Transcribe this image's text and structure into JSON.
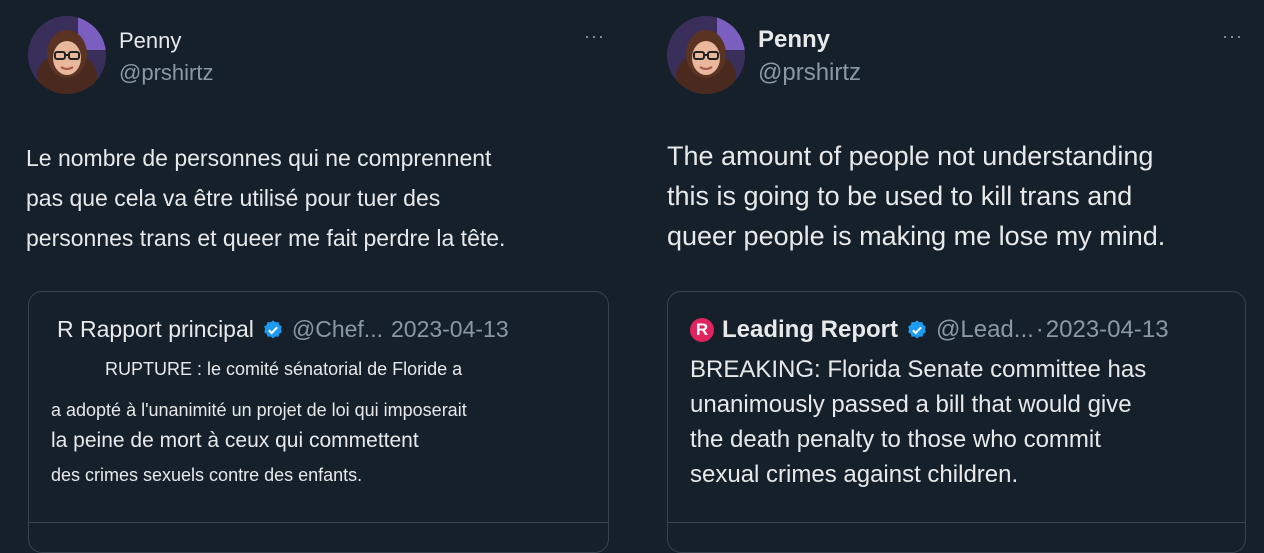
{
  "left": {
    "author": {
      "name": "Penny",
      "handle": "@prshirtz"
    },
    "more": "···",
    "text_lines": [
      "Le nombre de personnes qui ne comprennent",
      "pas que cela va être utilisé pour tuer des",
      "personnes trans et queer me fait perdre la tête."
    ],
    "quote": {
      "name": "R Rapport principal",
      "handle": "@Chef...",
      "date": "2023-04-13",
      "lines": [
        "RUPTURE : le comité sénatorial de Floride a",
        "a adopté à l'unanimité un projet de loi qui imposerait",
        "la peine de mort à ceux qui commettent",
        "des crimes sexuels contre des enfants."
      ]
    }
  },
  "right": {
    "author": {
      "name": "Penny",
      "handle": "@prshirtz"
    },
    "more": "···",
    "text_lines": [
      "The amount of people not understanding",
      "this is going to be used to kill trans and",
      "queer people is making me lose my mind."
    ],
    "quote": {
      "logo_letter": "R",
      "name": "Leading Report",
      "handle": "@Lead...",
      "separator": "·",
      "date": "2023-04-13",
      "lines": [
        "BREAKING: Florida Senate committee has",
        "unanimously passed a bill that would give",
        "the death penalty to those who commit",
        "sexual crimes against children."
      ]
    }
  },
  "colors": {
    "background": "#15202b",
    "text": "#e7e9ea",
    "muted": "#8b98a5",
    "verified": "#1d9bf0",
    "border": "#38444d",
    "logo": "#e0245e"
  },
  "icons": [
    "verified-badge-icon",
    "more-options-icon",
    "leading-report-logo-icon"
  ]
}
